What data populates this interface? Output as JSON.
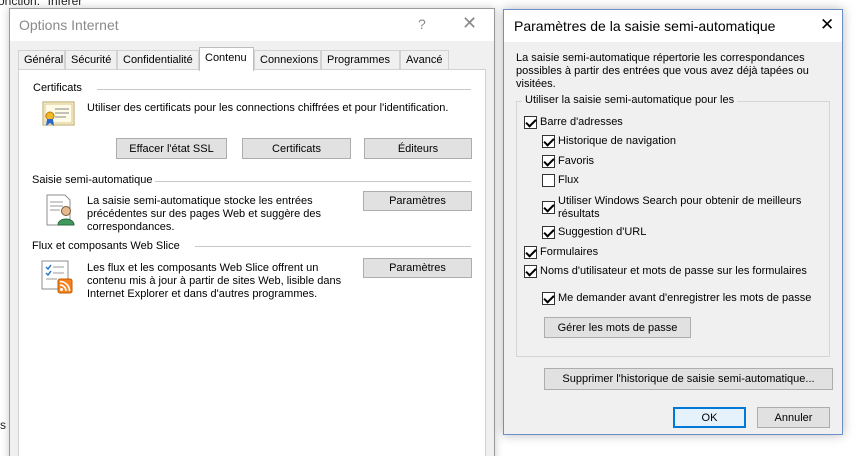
{
  "background": {
    "top_text": "onction: \"Inferer\"",
    "left_edge_text": "s"
  },
  "internet_options": {
    "title": "Options Internet",
    "help_glyph": "?",
    "close_glyph": "✕",
    "tabs": [
      {
        "label": "Général",
        "active": false
      },
      {
        "label": "Sécurité",
        "active": false
      },
      {
        "label": "Confidentialité",
        "active": false
      },
      {
        "label": "Contenu",
        "active": true
      },
      {
        "label": "Connexions",
        "active": false
      },
      {
        "label": "Programmes",
        "active": false
      },
      {
        "label": "Avancé",
        "active": false
      }
    ],
    "certificates": {
      "title": "Certificats",
      "description": "Utiliser des certificats pour les connections chiffrées et pour l'identification.",
      "icon": "certificate-icon",
      "buttons": {
        "clear_ssl": "Effacer l'état SSL",
        "certificates": "Certificats",
        "publishers": "Éditeurs"
      }
    },
    "autocomplete": {
      "title": "Saisie semi-automatique",
      "description": "La saisie semi-automatique stocke les entrées précédentes sur des pages Web et suggère des correspondances.",
      "icon": "autocomplete-user-icon",
      "settings_button": "Paramètres"
    },
    "feeds": {
      "title": "Flux et composants Web Slice",
      "description": "Les flux et les composants Web Slice offrent un contenu mis à jour à partir de sites Web, lisible dans Internet Explorer et dans d'autres programmes.",
      "icon": "rss-feed-icon",
      "settings_button": "Paramètres"
    }
  },
  "autocomplete_dialog": {
    "title": "Paramètres de la saisie semi-automatique",
    "close_glyph": "✕",
    "description": "La saisie semi-automatique répertorie les correspondances possibles à partir des entrées que vous avez déjà tapées ou visitées.",
    "group_label": "Utiliser la saisie semi-automatique pour les",
    "options": {
      "address_bar": {
        "label": "Barre d'adresses",
        "checked": true
      },
      "history": {
        "label": "Historique de navigation",
        "checked": true
      },
      "favorites": {
        "label": "Favoris",
        "checked": true
      },
      "feeds": {
        "label": "Flux",
        "checked": false
      },
      "windows_search": {
        "label": "Utiliser Windows Search pour obtenir de meilleurs résultats",
        "checked": true
      },
      "url_suggestion": {
        "label": "Suggestion d'URL",
        "checked": true
      },
      "forms": {
        "label": "Formulaires",
        "checked": true
      },
      "usernames_passwords": {
        "label": "Noms d'utilisateur et mots de passe sur les formulaires",
        "checked": true
      },
      "ask_before_saving": {
        "label": "Me demander avant d'enregistrer les mots de passe",
        "checked": true
      }
    },
    "manage_passwords_button": "Gérer les mots de passe",
    "clear_history_button": "Supprimer l'historique de saisie semi-automatique...",
    "ok_button": "OK",
    "cancel_button": "Annuler",
    "accent_color": "#0078d7"
  }
}
